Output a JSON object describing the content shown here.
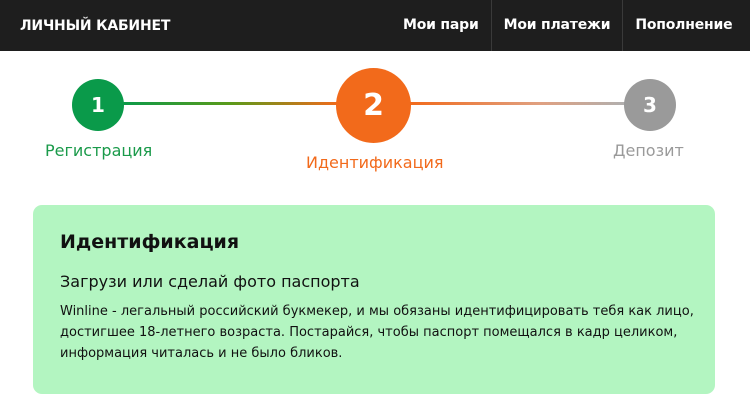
{
  "header": {
    "title": "ЛИЧНЫЙ КАБИНЕТ",
    "nav": [
      {
        "label": "Мои пари"
      },
      {
        "label": "Мои платежи"
      },
      {
        "label": "Пополнение"
      }
    ]
  },
  "stepper": {
    "current_step": 2,
    "steps": [
      {
        "number": "1",
        "label": "Регистрация",
        "state": "completed",
        "color": "#0a9a4a"
      },
      {
        "number": "2",
        "label": "Идентификация",
        "state": "current",
        "color": "#f26a1b"
      },
      {
        "number": "3",
        "label": "Депозит",
        "state": "upcoming",
        "color": "#9a9a9a"
      }
    ]
  },
  "card": {
    "title": "Идентификация",
    "subtitle": "Загрузи или сделай фото паспорта",
    "text": "Winline - легальный российский букмекер, и мы обязаны идентифицировать тебя как лицо, достигшее 18-летнего возраста. Постарайся, чтобы паспорт помещался в кадр целиком, информация читалась и не было бликов.",
    "background": "#b3f5c1"
  },
  "colors": {
    "header_bg": "#1e1e1e",
    "accent_green": "#0a9a4a",
    "accent_orange": "#f26a1b",
    "inactive_gray": "#9a9a9a"
  }
}
